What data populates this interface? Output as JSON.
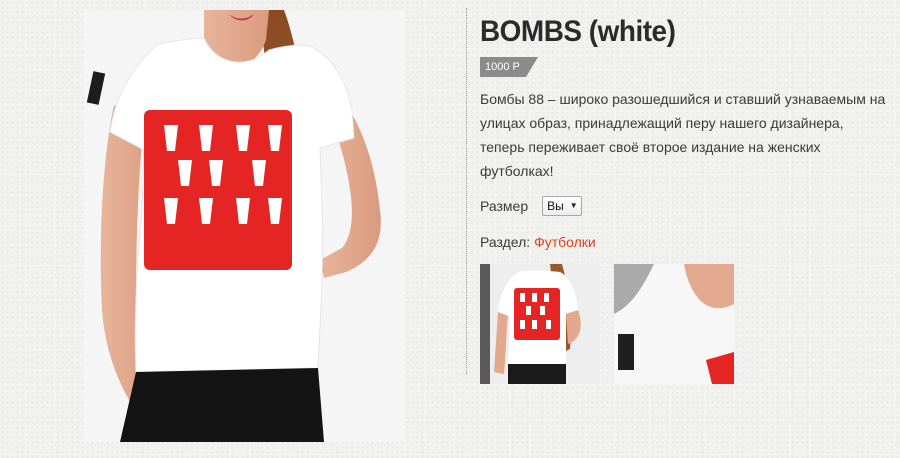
{
  "product": {
    "title": "BOMBS (white)",
    "price": "1000 Р",
    "description": "Бомбы 88 – широко разошедшийся и ставший узнаваемым на улицах образ, принадлежащий перу нашего дизайнера, теперь переживает своё второе издание на женских футболках!",
    "size_label": "Размер",
    "size_selected": "Вы",
    "section_label": "Раздел:",
    "section_link": "Футболки"
  },
  "colors": {
    "accent": "#e0401c",
    "print": "#e52424",
    "price_tag": "#8b8b8b"
  },
  "icons": {
    "size_dropdown": "chevron-down-icon"
  }
}
